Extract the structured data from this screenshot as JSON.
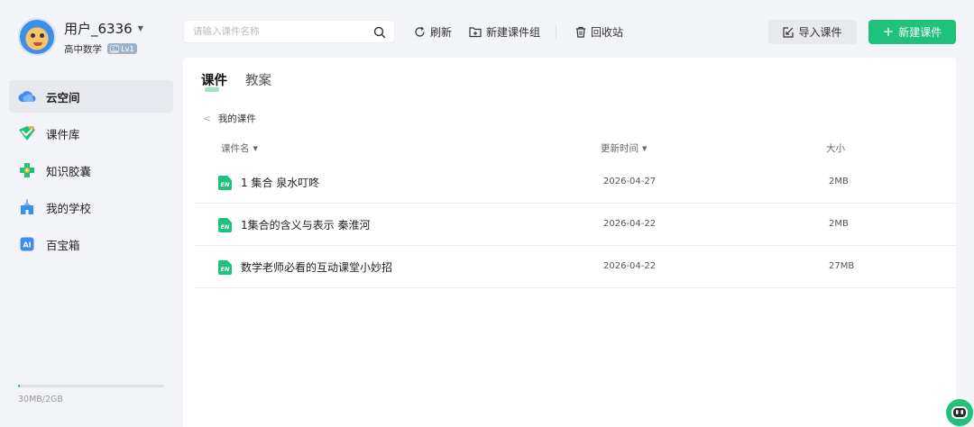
{
  "user": {
    "name": "用户_6336",
    "subject": "高中数学",
    "badge_en": "EN",
    "badge_level": "Lv1"
  },
  "sidebar": {
    "items": [
      {
        "label": "云空间",
        "icon": "cloud-icon",
        "active": true
      },
      {
        "label": "课件库",
        "icon": "courseware-library-icon",
        "active": false
      },
      {
        "label": "知识胶囊",
        "icon": "capsule-icon",
        "active": false
      },
      {
        "label": "我的学校",
        "icon": "school-icon",
        "active": false
      },
      {
        "label": "百宝箱",
        "icon": "ai-toolbox-icon",
        "active": false
      }
    ],
    "storage": {
      "text": "30MB/2GB",
      "used_fraction": 0.015
    }
  },
  "toolbar": {
    "search_placeholder": "请输入课件名称",
    "refresh": "刷新",
    "new_group": "新建课件组",
    "recycle": "回收站",
    "import": "导入课件",
    "new": "新建课件"
  },
  "tabs": [
    {
      "label": "课件",
      "active": true
    },
    {
      "label": "教案",
      "active": false
    }
  ],
  "breadcrumb": {
    "current": "我的课件"
  },
  "table": {
    "headers": {
      "name": "课件名",
      "updated": "更新时间",
      "size": "大小"
    },
    "rows": [
      {
        "name": "1 集合 泉水叮咚",
        "updated": "2026-04-27",
        "size": "2MB",
        "icon_text": "EN"
      },
      {
        "name": "1集合的含义与表示 秦淮河",
        "updated": "2026-04-22",
        "size": "2MB",
        "icon_text": "EN"
      },
      {
        "name": "数学老师必看的互动课堂小妙招",
        "updated": "2026-04-22",
        "size": "27MB",
        "icon_text": "EN"
      }
    ]
  },
  "colors": {
    "accent": "#1ec27a",
    "background": "#f3f4f7",
    "panel": "#ffffff"
  }
}
